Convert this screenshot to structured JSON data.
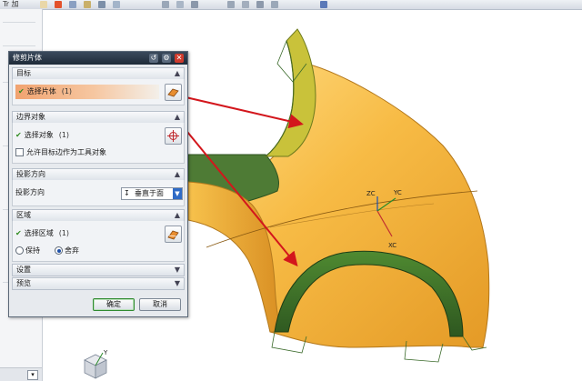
{
  "toolbar": {
    "text": "Tr 加"
  },
  "dialog": {
    "title": "修剪片体",
    "target": {
      "header": "目标",
      "select_label": "选择片体",
      "select_count": "(1)"
    },
    "boundary": {
      "header": "边界对象",
      "select_label": "选择对象",
      "select_count": "(1)",
      "allow_edge_label": "允许目标边作为工具对象"
    },
    "projection": {
      "header": "投影方向",
      "label": "投影方向",
      "selected": "垂直于面"
    },
    "region": {
      "header": "区域",
      "select_label": "选择区域",
      "select_count": "(1)",
      "keep_label": "保持",
      "discard_label": "舍弃"
    },
    "settings_header": "设置",
    "preview_header": "预览",
    "ok_label": "确定",
    "cancel_label": "取消"
  },
  "viewport": {
    "axis_labels": {
      "zc": "ZC",
      "yc": "YC",
      "xc": "XC",
      "y": "Y"
    }
  },
  "colors": {
    "surface": "#f4b23c",
    "surface_highlight": "#ffd77a",
    "trim_strip": "#3d6b2a",
    "arrow": "#d3161c",
    "title_bar": "#2b3a4b"
  }
}
